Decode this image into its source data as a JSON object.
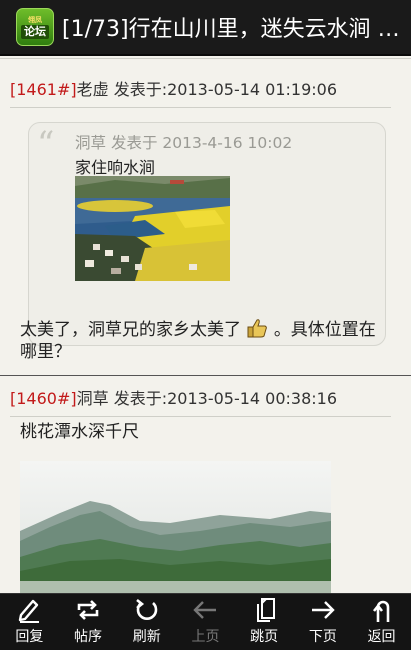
{
  "app": {
    "icon_top": "翎凤",
    "icon_bottom": "论坛",
    "title": "[1/73]行在山川里，迷失云水涧 …"
  },
  "posts": [
    {
      "floor": "[1461#]",
      "author": "老虚",
      "posted_prefix": " 发表于:",
      "timestamp": "2013-05-14 01:19:06",
      "quote": {
        "author": "洞草",
        "posted_prefix": " 发表于 ",
        "timestamp": "2013-4-16 10:02",
        "text": "家住响水涧",
        "image": "rapeseed-field-photo"
      },
      "body_line1": "太美了，洞草兄的家乡太美了",
      "emoji": "thumbs-up-emoji",
      "body_line1_end": "。具体位置在",
      "body_line2": "哪里？"
    },
    {
      "floor": "[1460#]",
      "author": "洞草",
      "posted_prefix": " 发表于:",
      "timestamp": "2013-05-14 00:38:16",
      "body": "桃花潭水深千尺",
      "image": "mountain-landscape-photo"
    }
  ],
  "toolbar": [
    {
      "label": "回复",
      "icon": "pencil-icon",
      "enabled": true
    },
    {
      "label": "帖序",
      "icon": "loop-arrows-icon",
      "enabled": true
    },
    {
      "label": "刷新",
      "icon": "refresh-icon",
      "enabled": true
    },
    {
      "label": "上页",
      "icon": "arrow-left-icon",
      "enabled": false
    },
    {
      "label": "跳页",
      "icon": "pages-icon",
      "enabled": true
    },
    {
      "label": "下页",
      "icon": "arrow-right-icon",
      "enabled": true
    },
    {
      "label": "返回",
      "icon": "return-icon",
      "enabled": true
    }
  ],
  "colors": {
    "floor_number": "#c21a1a",
    "background": "#f3f2ec",
    "bar": "#141414"
  }
}
